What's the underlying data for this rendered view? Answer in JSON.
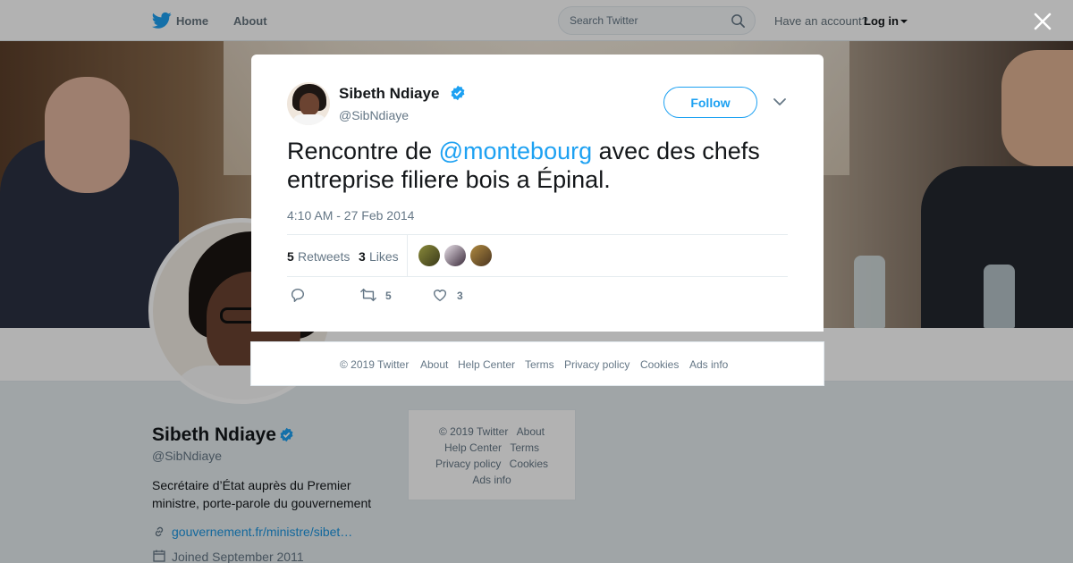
{
  "nav": {
    "home": "Home",
    "about": "About",
    "search_placeholder": "Search Twitter",
    "account_prompt": "Have an account?",
    "login": "Log in"
  },
  "profile": {
    "name": "Sibeth Ndiaye",
    "handle": "@SibNdiaye",
    "bio": "Secrétaire d’État auprès du Premier ministre, porte-parole du gouvernement",
    "link": "gouvernement.fr/ministre/sibet…",
    "joined": "Joined September 2011"
  },
  "side_footer": {
    "copyright": "© 2019 Twitter",
    "about": "About",
    "help": "Help Center",
    "terms": "Terms",
    "privacy": "Privacy policy",
    "cookies": "Cookies",
    "ads": "Ads info"
  },
  "tweet": {
    "author_name": "Sibeth Ndiaye",
    "author_handle": "@SibNdiaye",
    "follow_label": "Follow",
    "text_before": "Rencontre de ",
    "mention": "@montebourg",
    "text_after": " avec des chefs entreprise filiere bois a Épinal.",
    "timestamp": "4:10 AM - 27 Feb 2014",
    "retweets_count": "5",
    "retweets_label": "Retweets",
    "likes_count": "3",
    "likes_label": "Likes",
    "action_retweet_count": "5",
    "action_like_count": "3"
  },
  "modal_footer": {
    "copyright": "© 2019 Twitter",
    "about": "About",
    "help": "Help Center",
    "terms": "Terms",
    "privacy": "Privacy policy",
    "cookies": "Cookies",
    "ads": "Ads info"
  },
  "colors": {
    "brand_blue": "#1da1f2",
    "link_blue": "#1b95e0",
    "text_dark": "#14171a",
    "text_muted": "#657786"
  },
  "icons": [
    "twitter-bird-icon",
    "search-icon",
    "caret-down-icon",
    "close-icon",
    "verified-badge-icon",
    "chevron-down-icon",
    "reply-icon",
    "retweet-icon",
    "like-heart-icon",
    "link-icon",
    "calendar-icon"
  ]
}
